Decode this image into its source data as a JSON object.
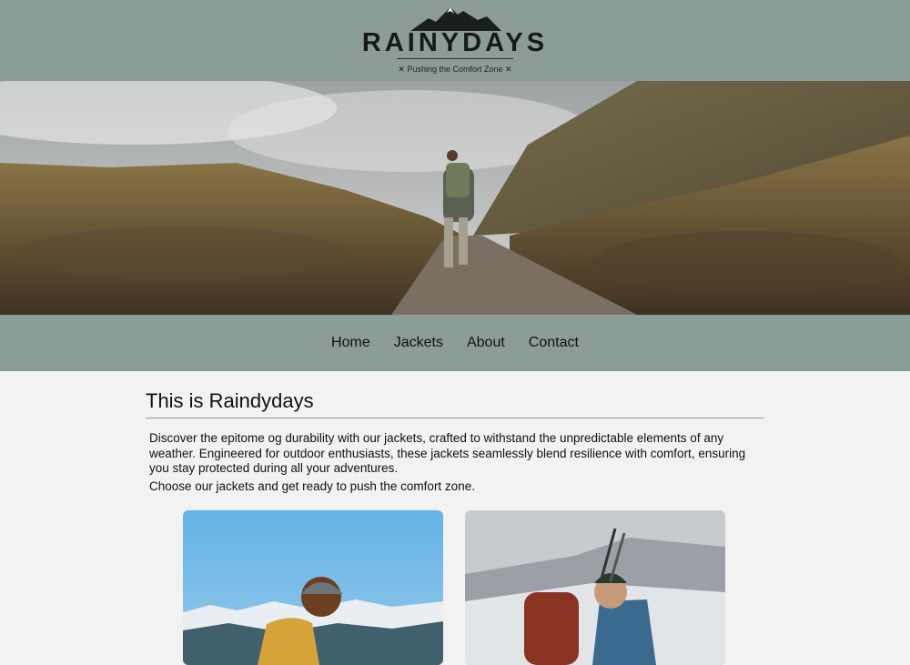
{
  "brand": {
    "name": "RAINYDAYS",
    "tagline": "✕ Pushing the Comfort Zone ✕",
    "icon": "mountain-logo-icon"
  },
  "nav": {
    "items": [
      {
        "label": "Home"
      },
      {
        "label": "Jackets"
      },
      {
        "label": "About"
      },
      {
        "label": "Contact"
      }
    ]
  },
  "main": {
    "title": "This is Raindydays",
    "paragraph_1": "Discover the epitome og durability with our jackets, crafted to withstand the unpredictable elements of any weather. Engineered for outdoor enthusiasts, these jackets seamlessly blend resilience with comfort, ensuring you stay protected during all your adventures.",
    "paragraph_2": "Choose our jackets and get ready to push the comfort zone."
  },
  "colors": {
    "header_bg": "#8c9d98",
    "page_bg": "#f2f2f2"
  }
}
